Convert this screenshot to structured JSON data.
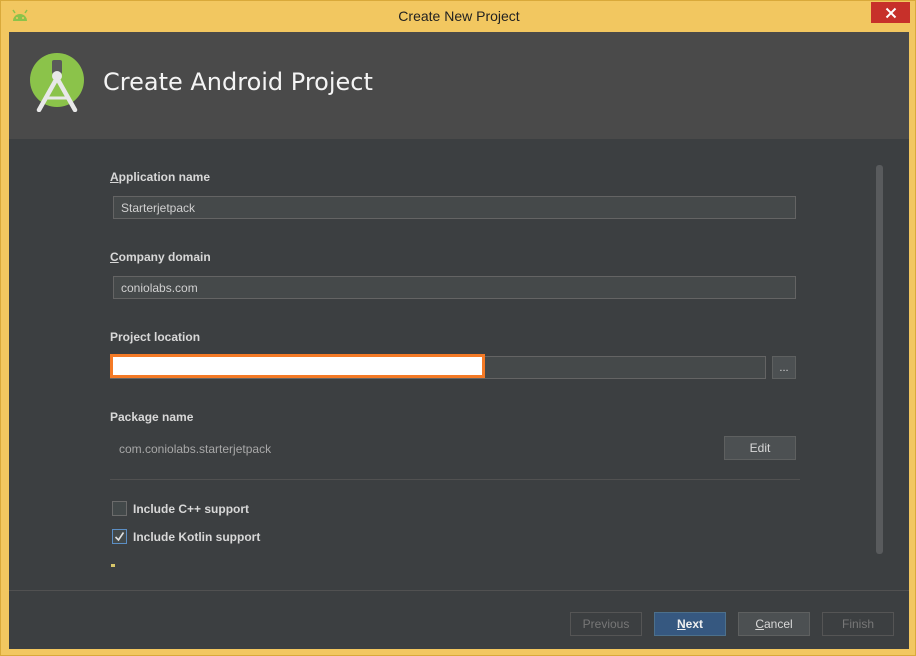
{
  "window": {
    "title": "Create New Project",
    "close_icon": "close-icon",
    "app_icon": "android-icon"
  },
  "header": {
    "title": "Create Android Project",
    "logo_icon": "android-studio-logo-icon"
  },
  "form": {
    "application_name": {
      "label_accel": "A",
      "label_rest": "pplication name",
      "value": "Starterjetpack"
    },
    "company_domain": {
      "label_accel": "C",
      "label_rest": "ompany domain",
      "value": "coniolabs.com"
    },
    "project_location": {
      "label": "Project location",
      "value": "",
      "browse_label": "..."
    },
    "package_name": {
      "label": "Package name",
      "value": "com.coniolabs.starterjetpack",
      "edit_label": "Edit"
    },
    "include_cpp": {
      "label": "Include C++ support",
      "checked": false
    },
    "include_kotlin": {
      "label": "Include Kotlin support",
      "checked": true
    }
  },
  "footer": {
    "previous": "Previous",
    "next_accel": "N",
    "next_rest": "ext",
    "cancel_accel": "C",
    "cancel_rest": "ancel",
    "finish": "Finish"
  },
  "colors": {
    "title_bar": "#f2c760",
    "close_button": "#c7302a",
    "dialog_bg": "#3c3f41",
    "header_bg": "#4a4a4a",
    "primary_button": "#365880",
    "redaction_border": "#f47a26",
    "android_green": "#8bc34a"
  }
}
